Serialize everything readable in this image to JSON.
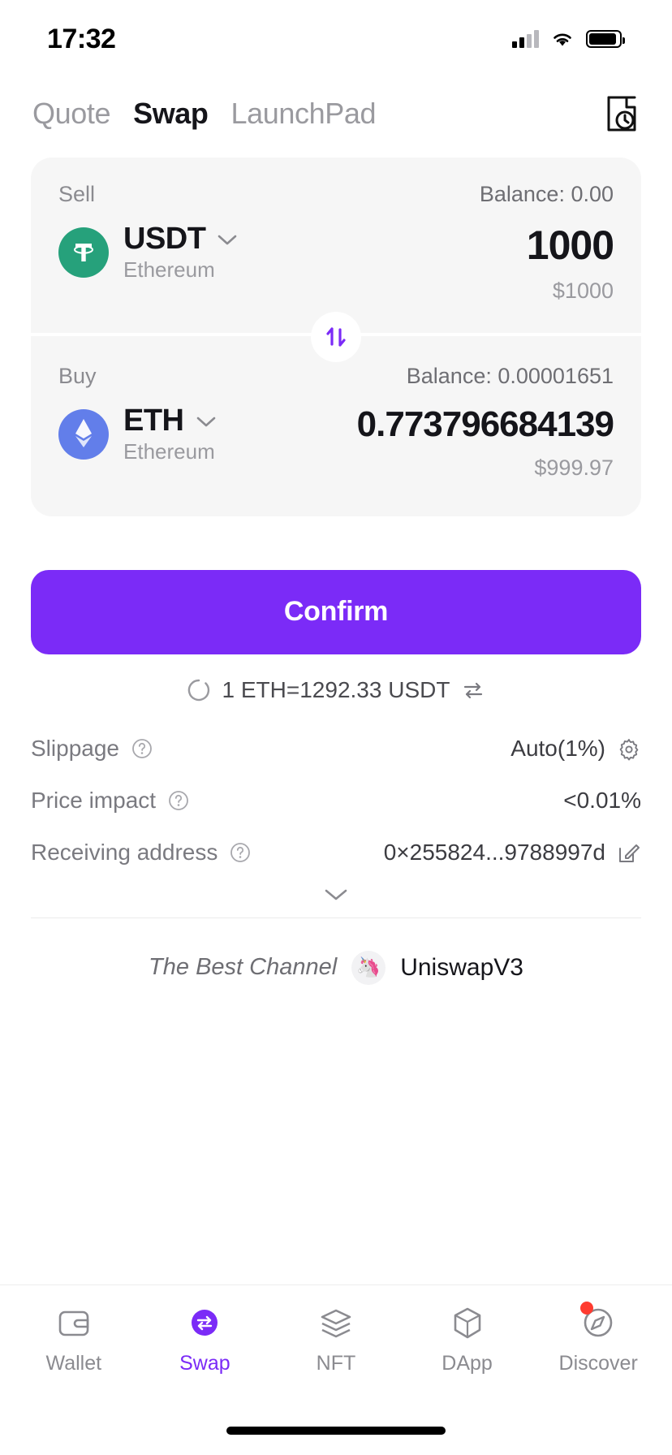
{
  "status_bar": {
    "time": "17:32",
    "signal_icon": "cellular-signal-icon",
    "wifi_icon": "wifi-icon",
    "battery_icon": "battery-icon"
  },
  "header": {
    "tabs": [
      {
        "label": "Quote",
        "active": false
      },
      {
        "label": "Swap",
        "active": true
      },
      {
        "label": "LaunchPad",
        "active": false
      }
    ],
    "history_icon": "history-clock-icon"
  },
  "swap_card": {
    "sell": {
      "label": "Sell",
      "balance": "Balance: 0.00",
      "token_symbol": "USDT",
      "token_chain": "Ethereum",
      "token_icon": "tether-usdt-icon",
      "token_color": "#26A17B",
      "amount": "1000",
      "fiat": "$1000",
      "chevron_icon": "chevron-down-icon"
    },
    "buy": {
      "label": "Buy",
      "balance": "Balance: 0.00001651",
      "token_symbol": "ETH",
      "token_chain": "Ethereum",
      "token_icon": "ethereum-icon",
      "token_color": "#627EEA",
      "amount": "0.773796684139",
      "fiat": "$999.97",
      "chevron_icon": "chevron-down-icon"
    },
    "toggle_icon": "swap-direction-arrows-icon",
    "toggle_color": "#7B2BF7"
  },
  "confirm_button": {
    "label": "Confirm",
    "color": "#7B2BF7"
  },
  "rate": {
    "spinner_icon": "loading-spinner-icon",
    "text": "1 ETH=1292.33 USDT",
    "reverse_icon": "reverse-rate-icon"
  },
  "details": [
    {
      "label": "Slippage",
      "help_icon": "question-mark-icon",
      "value": "Auto(1%)",
      "trailing_icon": "gear-icon"
    },
    {
      "label": "Price impact",
      "help_icon": "question-mark-icon",
      "value": "<0.01%",
      "trailing_icon": ""
    },
    {
      "label": "Receiving address",
      "help_icon": "question-mark-icon",
      "value": "0×255824...9788997d",
      "trailing_icon": "edit-icon"
    }
  ],
  "expander_icon": "chevron-down-icon",
  "channel": {
    "label": "The Best Channel",
    "badge_icon": "unicorn-icon",
    "badge_glyph": "🦄",
    "name": "UniswapV3"
  },
  "bottom_nav": [
    {
      "label": "Wallet",
      "icon": "wallet-icon",
      "active": false,
      "badge": false
    },
    {
      "label": "Swap",
      "icon": "swap-icon",
      "active": true,
      "badge": false
    },
    {
      "label": "NFT",
      "icon": "nft-layers-icon",
      "active": false,
      "badge": false
    },
    {
      "label": "DApp",
      "icon": "dapp-cube-icon",
      "active": false,
      "badge": false
    },
    {
      "label": "Discover",
      "icon": "compass-icon",
      "active": false,
      "badge": true
    }
  ]
}
